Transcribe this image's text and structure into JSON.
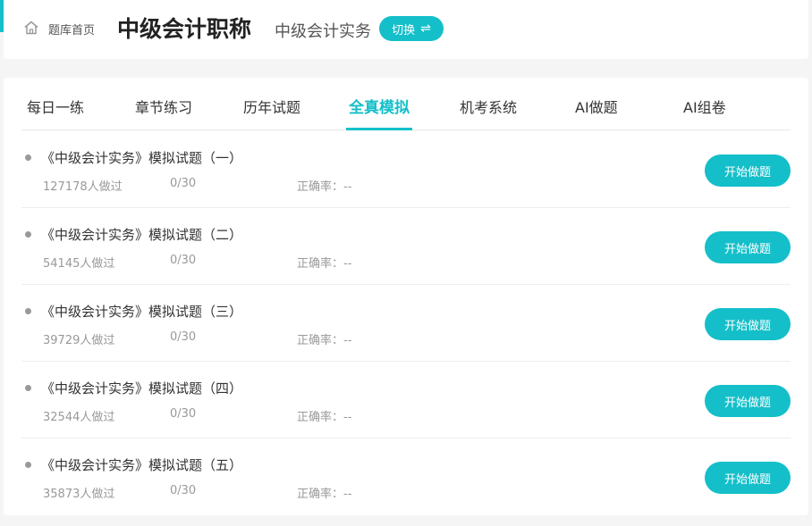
{
  "header": {
    "home_label": "题库首页",
    "title": "中级会计职称",
    "subject": "中级会计实务",
    "switch_label": "切换",
    "switch_icon": "⇌"
  },
  "tabs": [
    {
      "label": "每日一练",
      "active": false
    },
    {
      "label": "章节练习",
      "active": false
    },
    {
      "label": "历年试题",
      "active": false
    },
    {
      "label": "全真模拟",
      "active": true
    },
    {
      "label": "机考系统",
      "active": false
    },
    {
      "label": "AI做题",
      "active": false
    },
    {
      "label": "AI组卷",
      "active": false
    }
  ],
  "exams": [
    {
      "title": "《中级会计实务》模拟试题（一）",
      "count": "127178人做过",
      "progress": "0/30",
      "accuracy": "正确率：--",
      "button": "开始做题"
    },
    {
      "title": "《中级会计实务》模拟试题（二）",
      "count": "54145人做过",
      "progress": "0/30",
      "accuracy": "正确率：--",
      "button": "开始做题"
    },
    {
      "title": "《中级会计实务》模拟试题（三）",
      "count": "39729人做过",
      "progress": "0/30",
      "accuracy": "正确率：--",
      "button": "开始做题"
    },
    {
      "title": "《中级会计实务》模拟试题（四）",
      "count": "32544人做过",
      "progress": "0/30",
      "accuracy": "正确率：--",
      "button": "开始做题"
    },
    {
      "title": "《中级会计实务》模拟试题（五）",
      "count": "35873人做过",
      "progress": "0/30",
      "accuracy": "正确率：--",
      "button": "开始做题"
    }
  ],
  "colors": {
    "accent": "#14bfc9"
  }
}
